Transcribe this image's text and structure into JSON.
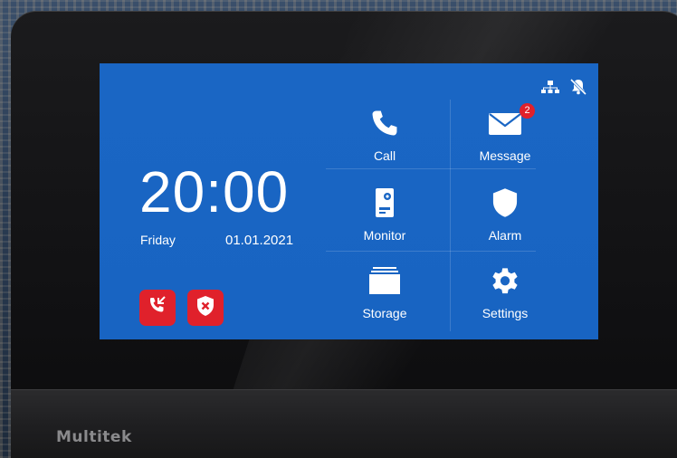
{
  "device": {
    "brand": "Multitek"
  },
  "status_bar": {
    "icons": [
      "network-icon",
      "bell-muted-icon"
    ]
  },
  "home": {
    "time": "20:00",
    "day": "Friday",
    "date": "01.01.2021"
  },
  "quick_actions": [
    {
      "icon": "missed-call-icon",
      "color": "#e0212b"
    },
    {
      "icon": "alarm-off-icon",
      "color": "#e0212b"
    }
  ],
  "menu": {
    "call": {
      "label": "Call",
      "icon": "phone-icon"
    },
    "message": {
      "label": "Message",
      "icon": "envelope-icon",
      "badge": "2"
    },
    "monitor": {
      "label": "Monitor",
      "icon": "door-station-icon"
    },
    "alarm": {
      "label": "Alarm",
      "icon": "shield-icon"
    },
    "storage": {
      "label": "Storage",
      "icon": "storage-icon"
    },
    "settings": {
      "label": "Settings",
      "icon": "gear-icon"
    }
  },
  "colors": {
    "screen": "#1a66c4",
    "accent_red": "#e0212b",
    "bezel": "#111113"
  }
}
